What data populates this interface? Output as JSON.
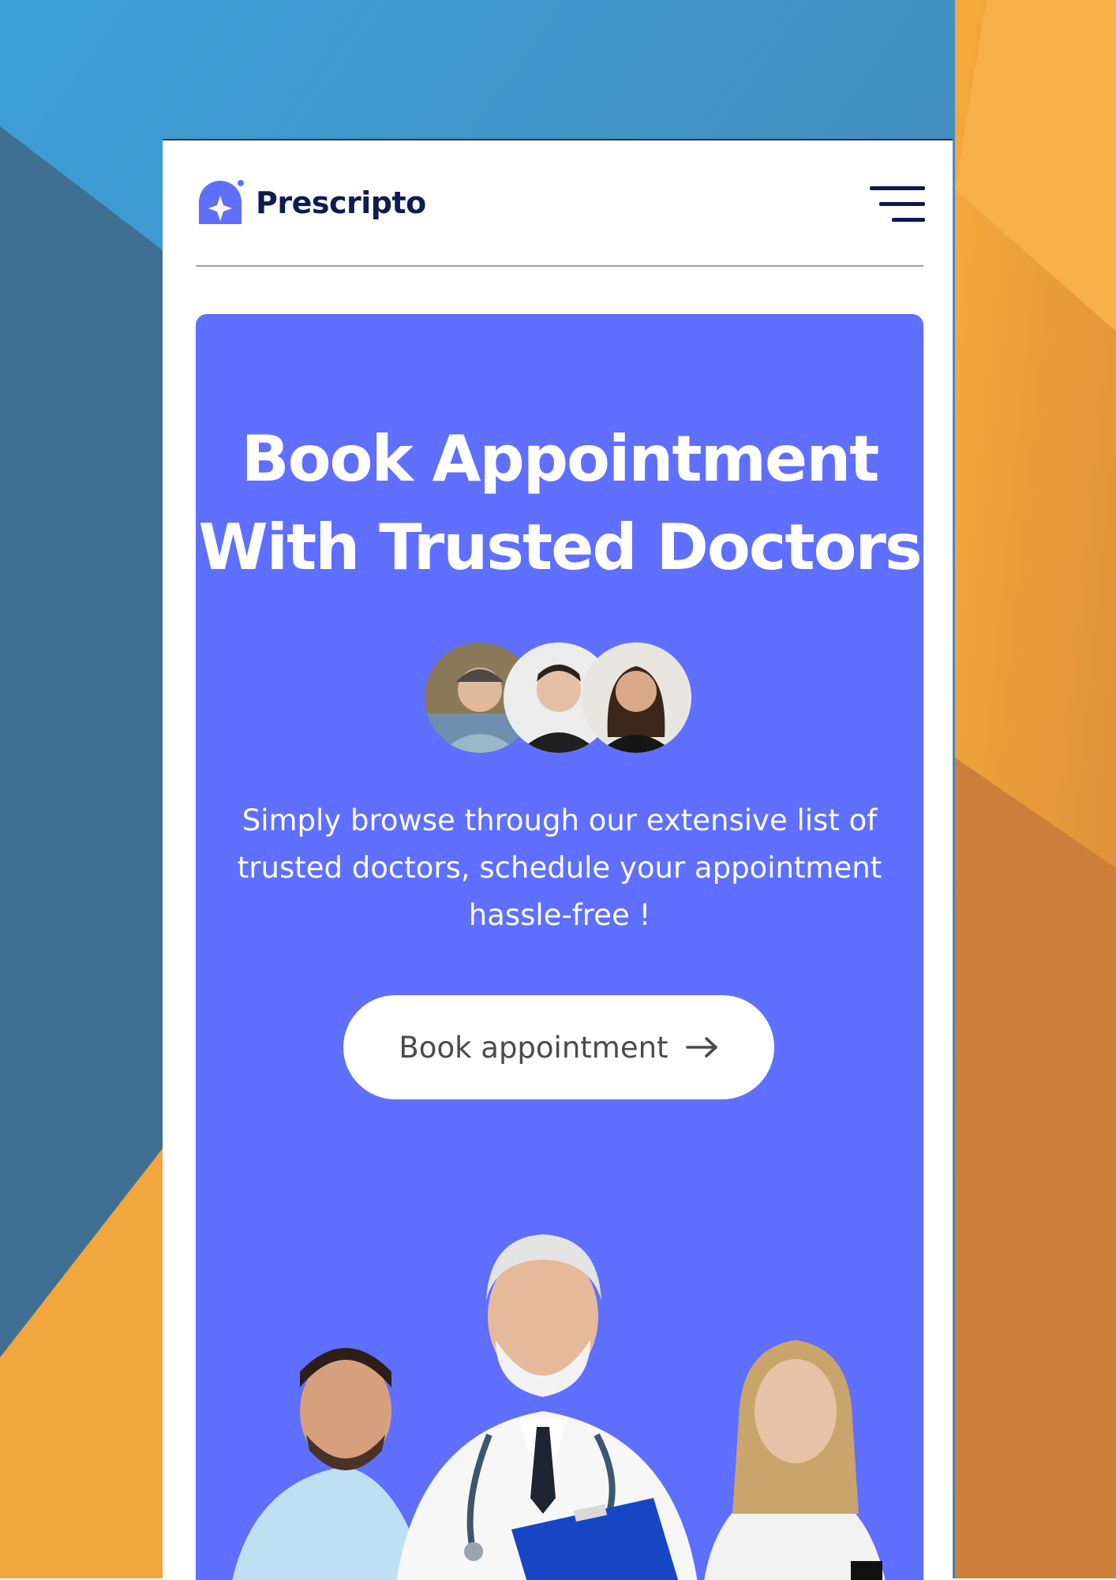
{
  "brand": {
    "name": "Prescripto"
  },
  "colors": {
    "primary": "#5f6fff",
    "navy": "#0d1b52",
    "white": "#ffffff"
  },
  "nav": {
    "menu_icon": "hamburger-menu-icon"
  },
  "hero": {
    "title_line1": "Book Appointment",
    "title_line2": "With Trusted Doctors",
    "subtitle": "Simply browse through our extensive list of trusted doctors, schedule your appointment hassle-free !",
    "cta_label": "Book appointment",
    "cta_icon": "arrow-right-icon"
  }
}
